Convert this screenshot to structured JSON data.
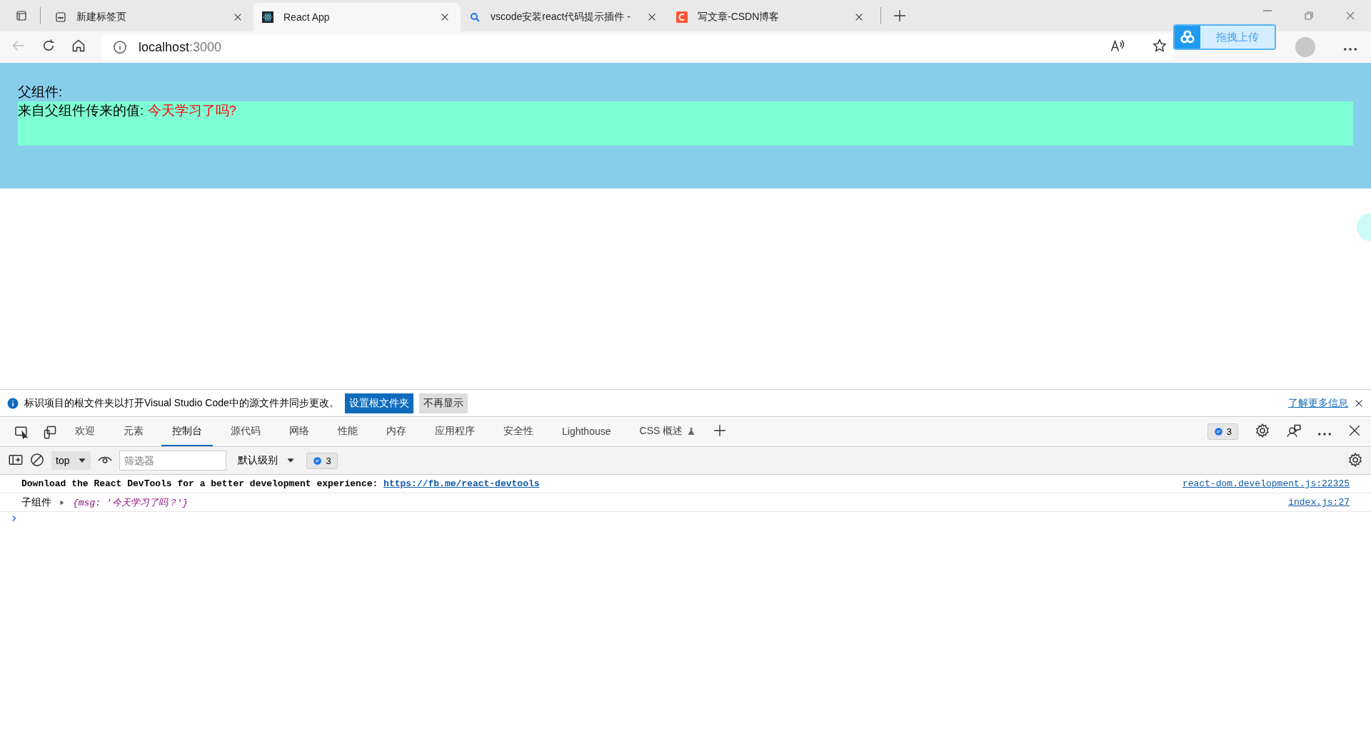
{
  "browser": {
    "tabs": [
      {
        "kind": "newtab",
        "title": "新建标签页",
        "selected": false
      },
      {
        "kind": "react",
        "title": "React App",
        "selected": true
      },
      {
        "kind": "search",
        "title": "vscode安装react代码提示插件 -",
        "selected": false
      },
      {
        "kind": "csdn",
        "title": "写文章-CSDN博客",
        "selected": false
      }
    ],
    "address": {
      "host": "localhost",
      "port": ":3000"
    },
    "upload_widget": {
      "label": "拖拽上传"
    }
  },
  "page": {
    "parent_label": "父组件:",
    "child_label": "来自父组件传来的值:",
    "child_value": "今天学习了吗?"
  },
  "devtools": {
    "infobar": {
      "message": "标识项目的根文件夹以打开Visual Studio Code中的源文件并同步更改。",
      "primary_button": "设置根文件夹",
      "secondary_button": "不再显示",
      "link": "了解更多信息"
    },
    "tabs": [
      {
        "label": "欢迎",
        "selected": false
      },
      {
        "label": "元素",
        "selected": false
      },
      {
        "label": "控制台",
        "selected": true
      },
      {
        "label": "源代码",
        "selected": false
      },
      {
        "label": "网络",
        "selected": false
      },
      {
        "label": "性能",
        "selected": false
      },
      {
        "label": "内存",
        "selected": false
      },
      {
        "label": "应用程序",
        "selected": false
      },
      {
        "label": "安全性",
        "selected": false
      },
      {
        "label": "Lighthouse",
        "selected": false
      },
      {
        "label": "CSS 概述",
        "selected": false,
        "experimental": true
      }
    ],
    "issues_count": "3",
    "console_toolbar": {
      "context": "top",
      "filter_placeholder": "筛选器",
      "level": "默认级别",
      "messages_count": "3"
    },
    "messages": [
      {
        "kind": "text",
        "text": "Download the React DevTools for a better development experience:",
        "link": "https://fb.me/react-devtools",
        "source": "react-dom.development.js:22325"
      },
      {
        "kind": "object",
        "label": "子组件",
        "object": "{msg: '今天学习了吗？'}",
        "source": "index.js:27"
      }
    ]
  }
}
